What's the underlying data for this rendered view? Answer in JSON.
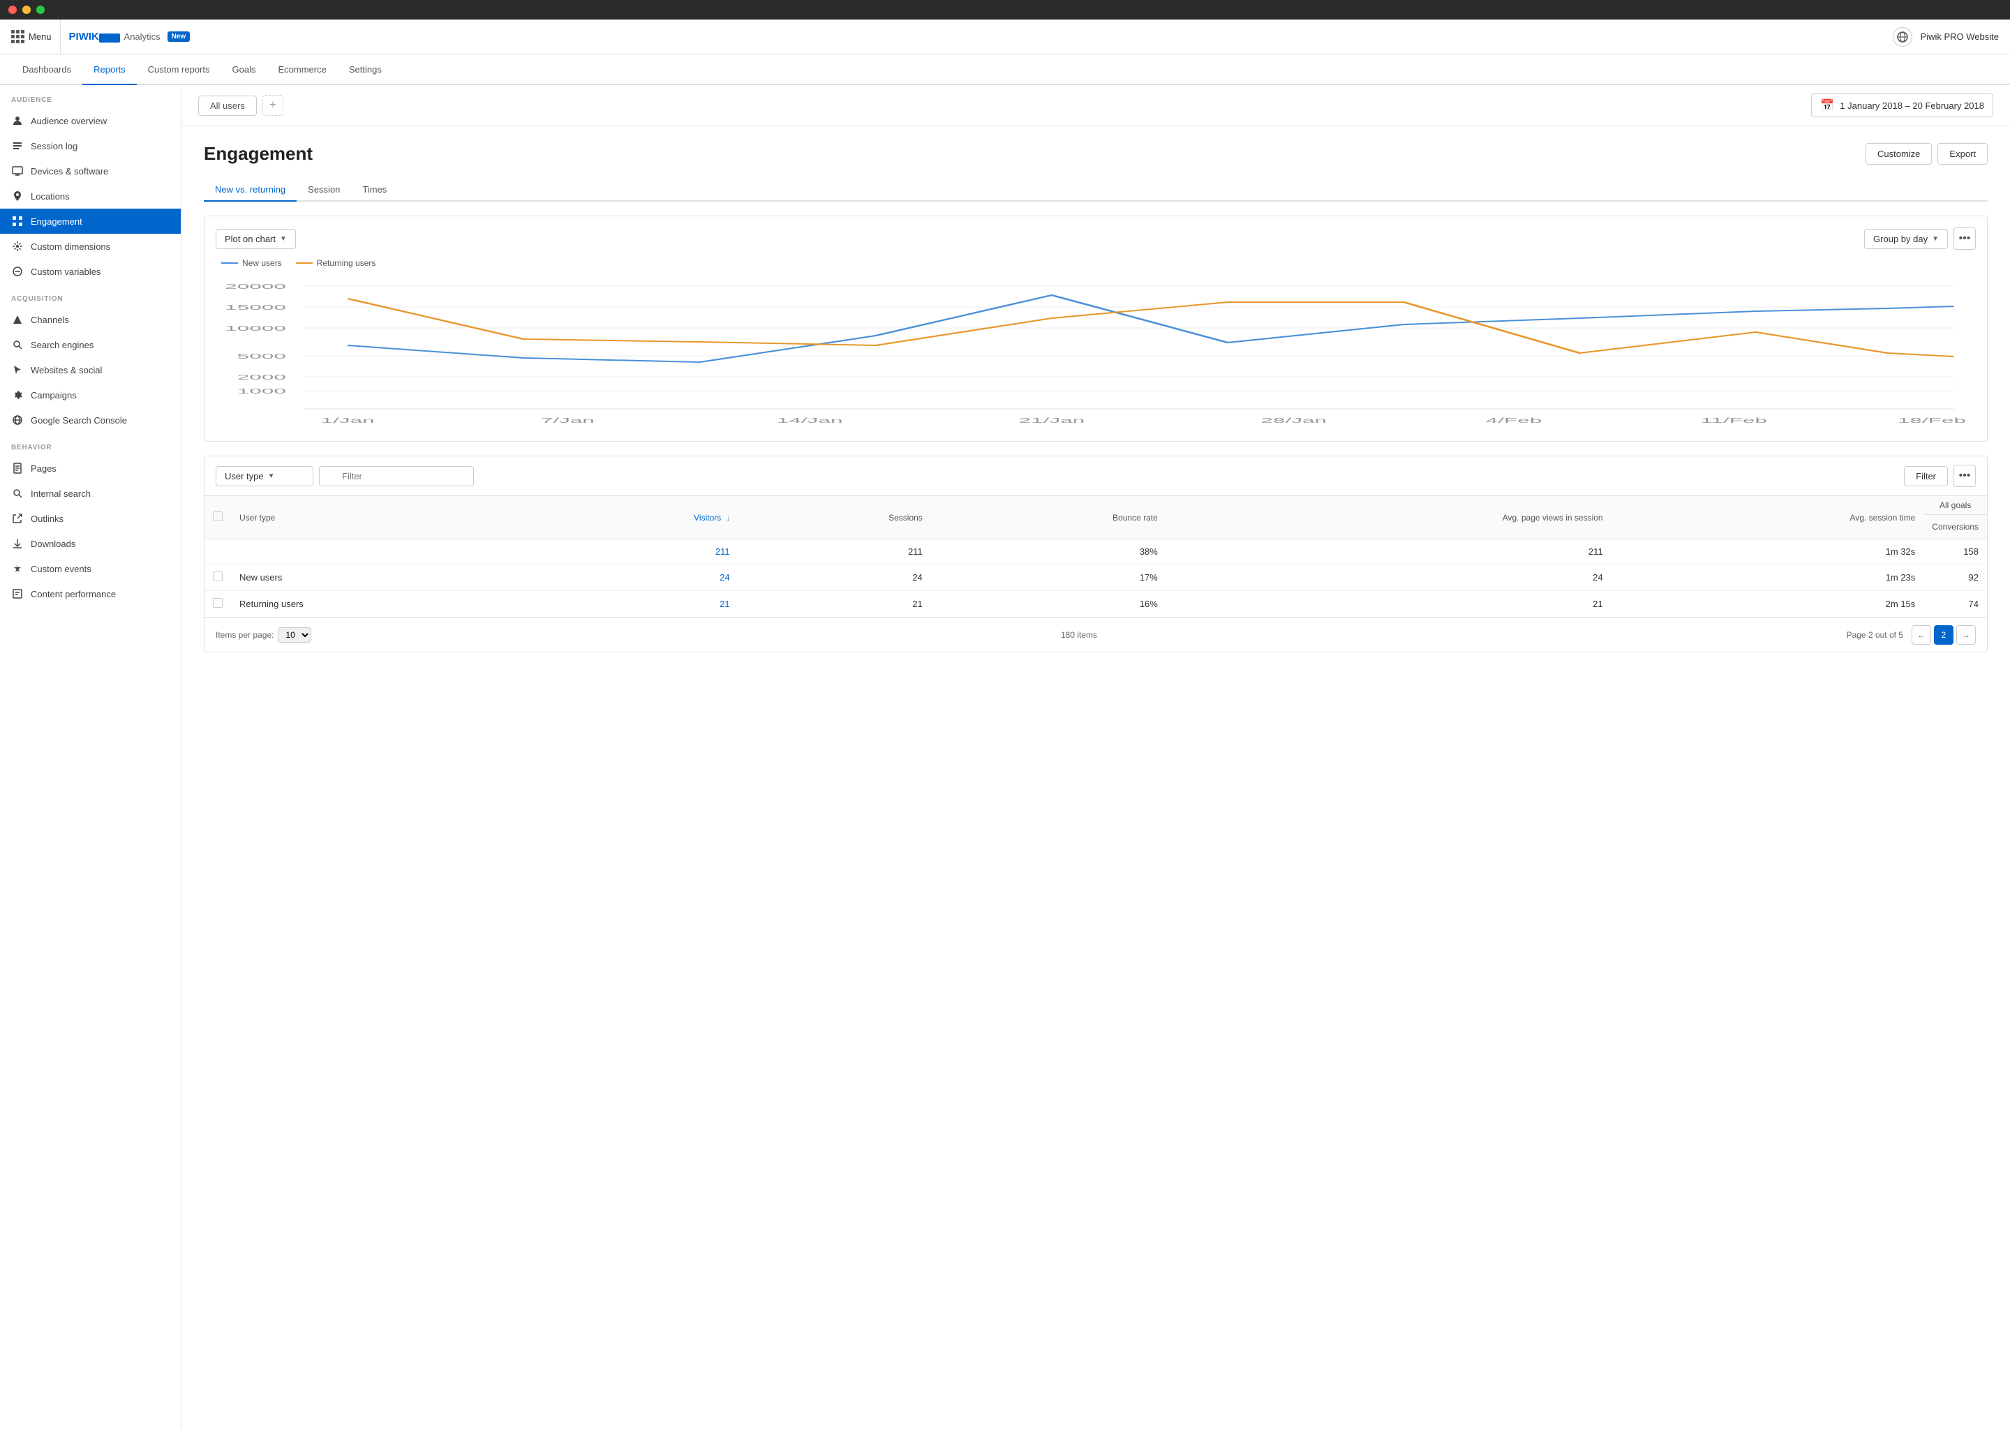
{
  "titlebar": {
    "buttons": [
      "close",
      "minimize",
      "maximize"
    ]
  },
  "topbar": {
    "menu_label": "Menu",
    "logo_piwik": "PIWIK",
    "logo_pro": "PRO",
    "logo_analytics": "Analytics",
    "logo_new": "New",
    "site_name": "Piwik PRO Website"
  },
  "subnav": {
    "items": [
      {
        "label": "Dashboards",
        "active": false
      },
      {
        "label": "Reports",
        "active": true
      },
      {
        "label": "Custom reports",
        "active": false
      },
      {
        "label": "Goals",
        "active": false
      },
      {
        "label": "Ecommerce",
        "active": false
      },
      {
        "label": "Settings",
        "active": false
      }
    ]
  },
  "sidebar": {
    "sections": [
      {
        "label": "AUDIENCE",
        "items": [
          {
            "label": "Audience overview",
            "icon": "person-icon",
            "active": false
          },
          {
            "label": "Session log",
            "icon": "list-icon",
            "active": false
          },
          {
            "label": "Devices & software",
            "icon": "desktop-icon",
            "active": false
          },
          {
            "label": "Locations",
            "icon": "pin-icon",
            "active": false
          },
          {
            "label": "Engagement",
            "icon": "engagement-icon",
            "active": true
          },
          {
            "label": "Custom dimensions",
            "icon": "dimensions-icon",
            "active": false
          },
          {
            "label": "Custom variables",
            "icon": "variables-icon",
            "active": false
          }
        ]
      },
      {
        "label": "ACQUISITION",
        "items": [
          {
            "label": "Channels",
            "icon": "channels-icon",
            "active": false
          },
          {
            "label": "Search engines",
            "icon": "search-icon",
            "active": false
          },
          {
            "label": "Websites & social",
            "icon": "cursor-icon",
            "active": false
          },
          {
            "label": "Campaigns",
            "icon": "gear-icon",
            "active": false
          },
          {
            "label": "Google Search Console",
            "icon": "globe-circle-icon",
            "active": false
          }
        ]
      },
      {
        "label": "BEHAVIOR",
        "items": [
          {
            "label": "Pages",
            "icon": "page-icon",
            "active": false
          },
          {
            "label": "Internal search",
            "icon": "internal-search-icon",
            "active": false
          },
          {
            "label": "Outlinks",
            "icon": "outlinks-icon",
            "active": false
          },
          {
            "label": "Downloads",
            "icon": "downloads-icon",
            "active": false
          },
          {
            "label": "Custom events",
            "icon": "events-icon",
            "active": false
          },
          {
            "label": "Content performance",
            "icon": "content-icon",
            "active": false
          }
        ]
      }
    ]
  },
  "segment_bar": {
    "tabs": [
      {
        "label": "All users",
        "filled": true
      }
    ],
    "add_label": "+",
    "date_range": "1 January 2018 – 20 February 2018"
  },
  "page": {
    "title": "Engagement",
    "actions": [
      {
        "label": "Customize"
      },
      {
        "label": "Export"
      }
    ],
    "tabs": [
      {
        "label": "New vs. returning",
        "active": true
      },
      {
        "label": "Session",
        "active": false
      },
      {
        "label": "Times",
        "active": false
      }
    ]
  },
  "chart": {
    "plot_on_chart_label": "Plot on chart",
    "group_by_label": "Group by day",
    "more_label": "•••",
    "legend": [
      {
        "label": "New users",
        "color": "blue"
      },
      {
        "label": "Returning users",
        "color": "orange"
      }
    ],
    "x_labels": [
      "1/Jan",
      "7/Jan",
      "14/Jan",
      "21/Jan",
      "28/Jan",
      "4/Feb",
      "11/Feb",
      "18/Feb"
    ],
    "y_labels": [
      "20000",
      "15000",
      "10000",
      "5000",
      "2000",
      "1000"
    ],
    "new_users_data": [
      5200,
      3000,
      2500,
      6500,
      14000,
      5700,
      8500,
      11000,
      12500,
      11500,
      12000
    ],
    "returning_users_data": [
      13500,
      6000,
      5500,
      5200,
      9500,
      13000,
      13000,
      4000,
      7000,
      7000,
      10000,
      4000,
      3500
    ]
  },
  "table": {
    "dropdown_label": "User type",
    "filter_placeholder": "Filter",
    "filter_btn_label": "Filter",
    "more_label": "•••",
    "all_goals_label": "All goals",
    "columns": [
      {
        "label": "",
        "key": "checkbox"
      },
      {
        "label": "User type",
        "key": "type",
        "align": "left"
      },
      {
        "label": "Visitors ↓",
        "key": "visitors",
        "sortable": true
      },
      {
        "label": "Sessions",
        "key": "sessions"
      },
      {
        "label": "Bounce rate",
        "key": "bounce_rate"
      },
      {
        "label": "Avg. page views in session",
        "key": "avg_pageviews"
      },
      {
        "label": "Avg. session time",
        "key": "avg_session_time"
      },
      {
        "label": "Conversions",
        "key": "conversions"
      }
    ],
    "rows": [
      {
        "type": "",
        "visitors": "211",
        "sessions": "211",
        "bounce_rate": "38%",
        "avg_pageviews": "211",
        "avg_session_time": "1m 32s",
        "conversions": "158"
      },
      {
        "type": "New users",
        "visitors": "24",
        "sessions": "24",
        "bounce_rate": "17%",
        "avg_pageviews": "24",
        "avg_session_time": "1m 23s",
        "conversions": "92"
      },
      {
        "type": "Returning users",
        "visitors": "21",
        "sessions": "21",
        "bounce_rate": "16%",
        "avg_pageviews": "21",
        "avg_session_time": "2m 15s",
        "conversions": "74"
      }
    ],
    "footer": {
      "items_per_page_label": "Items per page:",
      "items_per_page_value": "10",
      "total_items": "180 items",
      "page_label": "Page 2 out of 5",
      "current_page": "2"
    }
  }
}
